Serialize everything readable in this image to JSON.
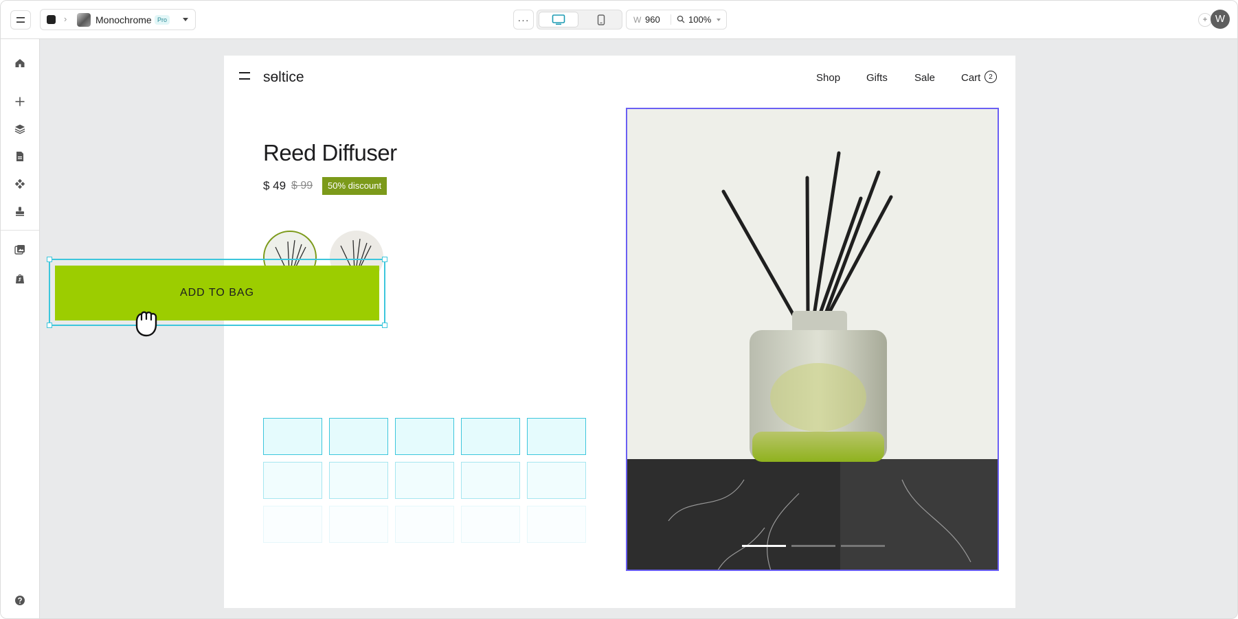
{
  "toolbar": {
    "project_name": "Monochrome",
    "plan_badge": "Pro",
    "more_label": "···",
    "width_label": "W",
    "width_value": "960",
    "zoom_value": "100%",
    "add_label": "+",
    "user_initial": "W"
  },
  "rail": {
    "icons": [
      "home-icon",
      "add-icon",
      "layers-icon",
      "pages-icon",
      "components-icon",
      "stamp-icon",
      "media-icon",
      "shopify-icon",
      "help-icon"
    ]
  },
  "site": {
    "logo": "sөltice",
    "nav": [
      "Shop",
      "Gifts",
      "Sale",
      "Cart"
    ],
    "cart_count": "2"
  },
  "product": {
    "title": "Reed Diffuser",
    "price": "$ 49",
    "old_price": "$ 99",
    "discount": "50% discount",
    "cta": "ADD TO BAG",
    "carousel": {
      "slides": 3,
      "active": 1
    }
  },
  "colors": {
    "accent": "#9ccd00",
    "discount_badge": "#7c9a1a",
    "selection": "#3cc6dc",
    "image_frame": "#6a5ff3"
  }
}
